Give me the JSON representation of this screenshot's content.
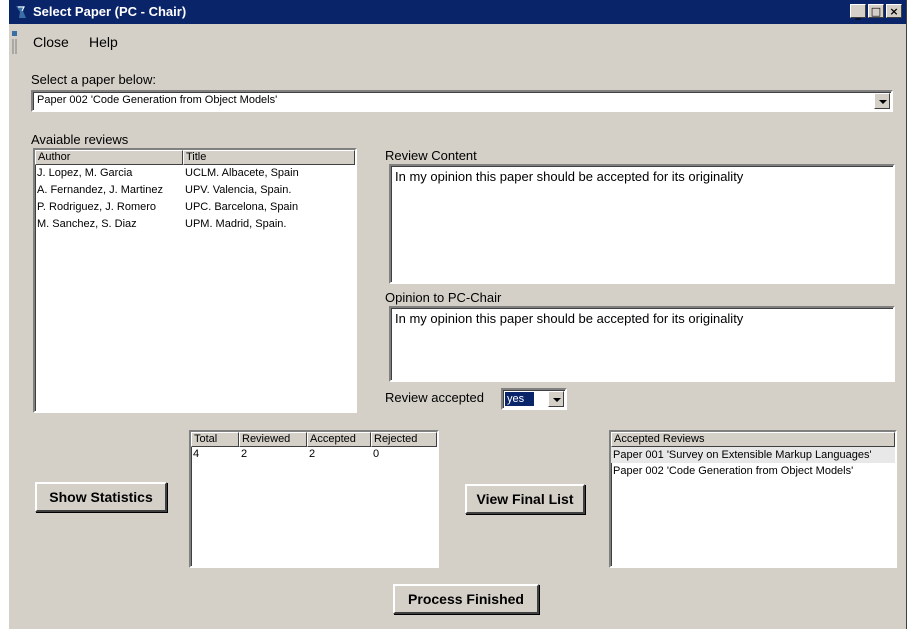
{
  "window": {
    "title": "Select Paper (PC - Chair)"
  },
  "menu": {
    "close": "Close",
    "help": "Help"
  },
  "paper_select": {
    "label": "Select a paper below:",
    "value": "Paper 002 'Code Generation from Object Models'"
  },
  "reviews": {
    "label": "Avaiable reviews",
    "columns": [
      "Author",
      "Title"
    ],
    "rows": [
      [
        "J. Lopez, M. Garcia",
        "UCLM. Albacete, Spain"
      ],
      [
        "A. Fernandez, J. Martinez",
        "UPV. Valencia, Spain."
      ],
      [
        "P. Rodriguez, J. Romero",
        "UPC. Barcelona, Spain"
      ],
      [
        "M. Sanchez, S. Diaz",
        "UPM. Madrid, Spain."
      ]
    ]
  },
  "review_content": {
    "label": "Review Content",
    "value": "In my opinion this paper should be accepted for its originality"
  },
  "opinion": {
    "label": "Opinion to PC-Chair",
    "value": "In my opinion this paper should be accepted for its originality"
  },
  "review_accepted": {
    "label": "Review accepted",
    "value": "yes"
  },
  "statistics": {
    "button": "Show Statistics",
    "columns": [
      "Total",
      "Reviewed",
      "Accepted",
      "Rejected"
    ],
    "values": [
      "4",
      "2",
      "2",
      "0"
    ]
  },
  "final_list": {
    "button": "View Final List",
    "header": "Accepted Reviews",
    "items": [
      "Paper 001 'Survey on Extensible Markup Languages'",
      "Paper 002 'Code Generation from Object Models'"
    ]
  },
  "process": {
    "button": "Process Finished"
  },
  "colors": {
    "titlebar": "#0a246a",
    "face": "#d4d0c8"
  }
}
